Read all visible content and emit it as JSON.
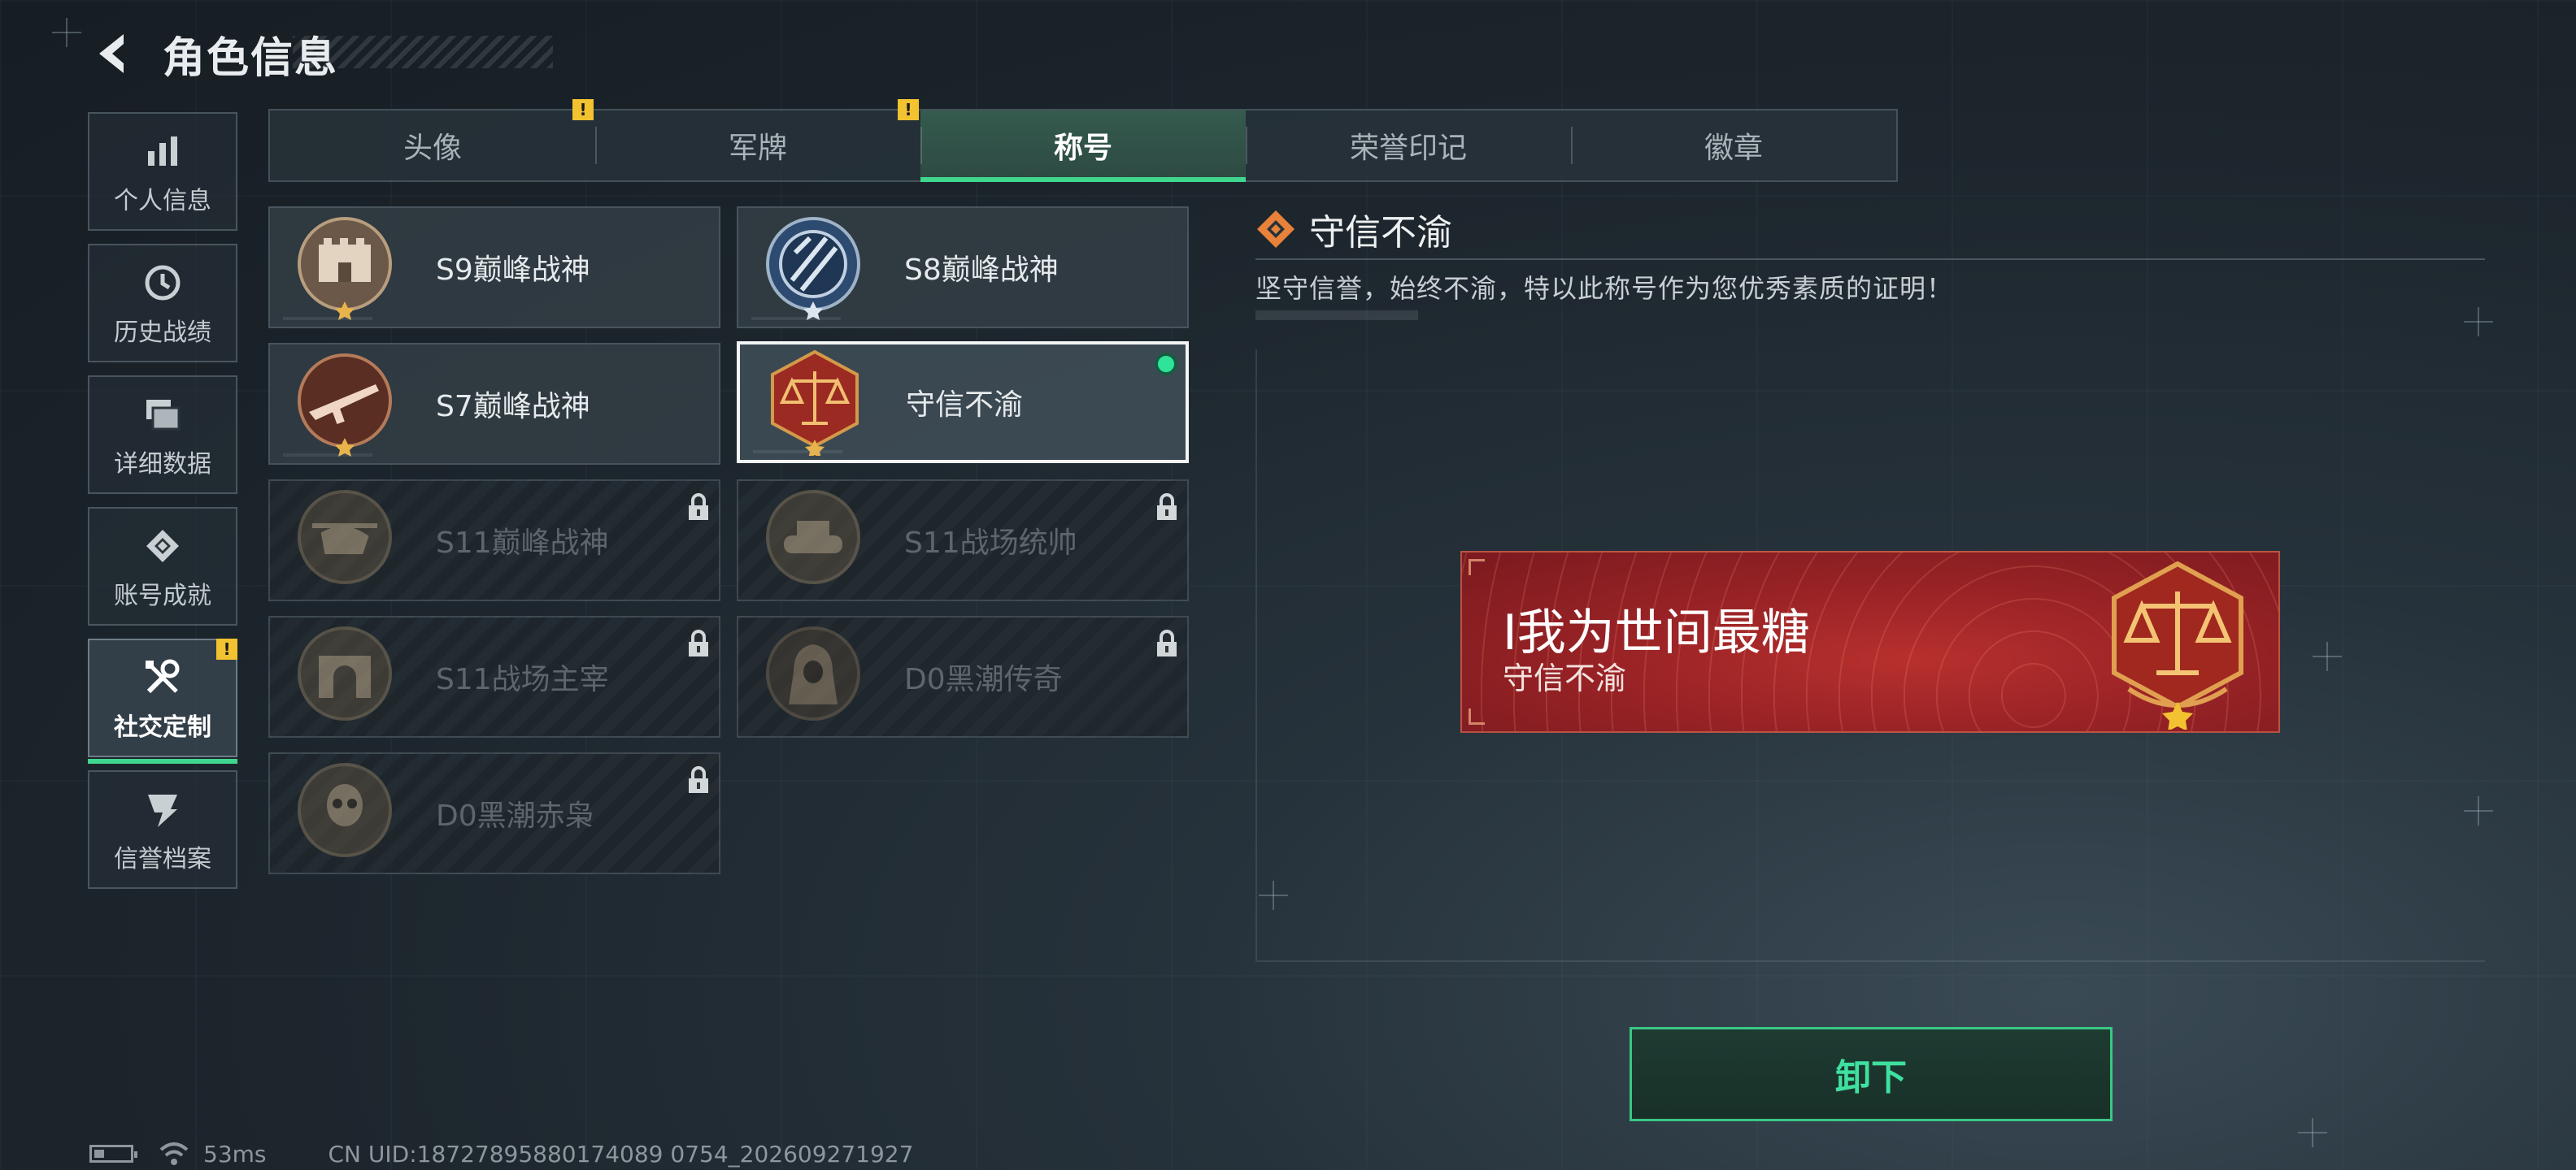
{
  "header": {
    "title": "角色信息"
  },
  "sidebar": {
    "items": [
      {
        "label": "个人信息",
        "icon": "bar-chart-icon"
      },
      {
        "label": "历史战绩",
        "icon": "history-clock-icon"
      },
      {
        "label": "详细数据",
        "icon": "stacked-cards-icon"
      },
      {
        "label": "账号成就",
        "icon": "achievement-icon"
      },
      {
        "label": "社交定制",
        "icon": "tools-icon",
        "active": true,
        "badge": "!"
      },
      {
        "label": "信誉档案",
        "icon": "credit-shield-icon"
      }
    ]
  },
  "tabs": [
    {
      "label": "头像",
      "badge": "!"
    },
    {
      "label": "军牌",
      "badge": "!"
    },
    {
      "label": "称号",
      "active": true
    },
    {
      "label": "荣誉印记"
    },
    {
      "label": "徽章"
    }
  ],
  "titles": [
    {
      "name": "S9巅峰战神",
      "emblem": "fortress-emblem-icon",
      "locked": false
    },
    {
      "name": "S8巅峰战神",
      "emblem": "blue-stripes-emblem-icon",
      "locked": false
    },
    {
      "name": "S7巅峰战神",
      "emblem": "rifle-emblem-icon",
      "locked": false
    },
    {
      "name": "守信不渝",
      "emblem": "scales-emblem-icon",
      "locked": false,
      "selected": true,
      "equipped": true
    },
    {
      "name": "S11巅峰战神",
      "emblem": "helicopter-emblem-icon",
      "locked": true
    },
    {
      "name": "S11战场统帅",
      "emblem": "tank-emblem-icon",
      "locked": true
    },
    {
      "name": "S11战场主宰",
      "emblem": "arch-emblem-icon",
      "locked": true
    },
    {
      "name": "D0黑潮传奇",
      "emblem": "hooded-figure-emblem-icon",
      "locked": true
    },
    {
      "name": "D0黑潮赤枭",
      "emblem": "skull-wings-emblem-icon",
      "locked": true
    }
  ],
  "detail": {
    "title": "守信不渝",
    "description": "坚守信誉，始终不渝，特以此称号作为您优秀素质的证明！"
  },
  "banner": {
    "player_name": "I我为世间最糖",
    "title_text": "守信不渝"
  },
  "actions": {
    "unequip_label": "卸下"
  },
  "status": {
    "ping": "53ms",
    "uid": "CN UID:18727895880174089 0754_202609271927"
  },
  "colors": {
    "accent_green": "#3fd68e",
    "badge_yellow": "#f2c230",
    "banner_red": "#9a2326"
  }
}
